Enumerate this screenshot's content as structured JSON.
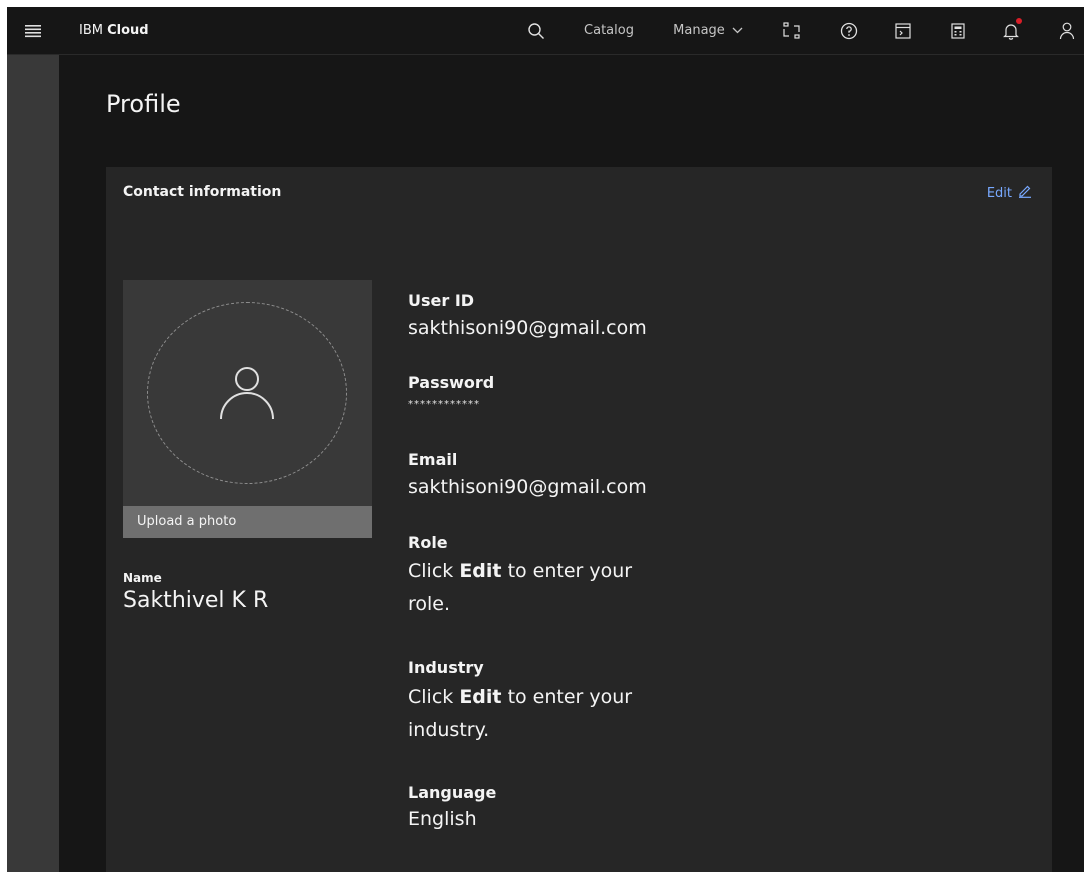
{
  "header": {
    "brand_prefix": "IBM",
    "brand_name": "Cloud",
    "catalog": "Catalog",
    "manage": "Manage",
    "icons": [
      "menu-icon",
      "search-icon",
      "switcher-icon",
      "help-icon",
      "terminal-icon",
      "calculator-icon",
      "notification-icon",
      "user-icon"
    ]
  },
  "page": {
    "title": "Profile"
  },
  "card": {
    "title": "Contact information",
    "edit": "Edit",
    "upload_photo": "Upload a photo",
    "name_label": "Name",
    "name_value": "Sakthivel K R",
    "user_id_label": "User ID",
    "user_id_value": "sakthisoni90@gmail.com",
    "password_label": "Password",
    "password_value": "************",
    "email_label": "Email",
    "email_value": "sakthisoni90@gmail.com",
    "role_label": "Role",
    "role_pre": "Click",
    "role_edit": "Edit",
    "role_post": "to enter your role.",
    "industry_label": "Industry",
    "industry_pre": "Click",
    "industry_edit": "Edit",
    "industry_post": "to enter your industry.",
    "language_label": "Language",
    "language_value": "English"
  },
  "colors": {
    "background": "#161616",
    "card": "#262626",
    "rail": "#393939",
    "link": "#78a9ff",
    "notification": "#da1e28"
  }
}
